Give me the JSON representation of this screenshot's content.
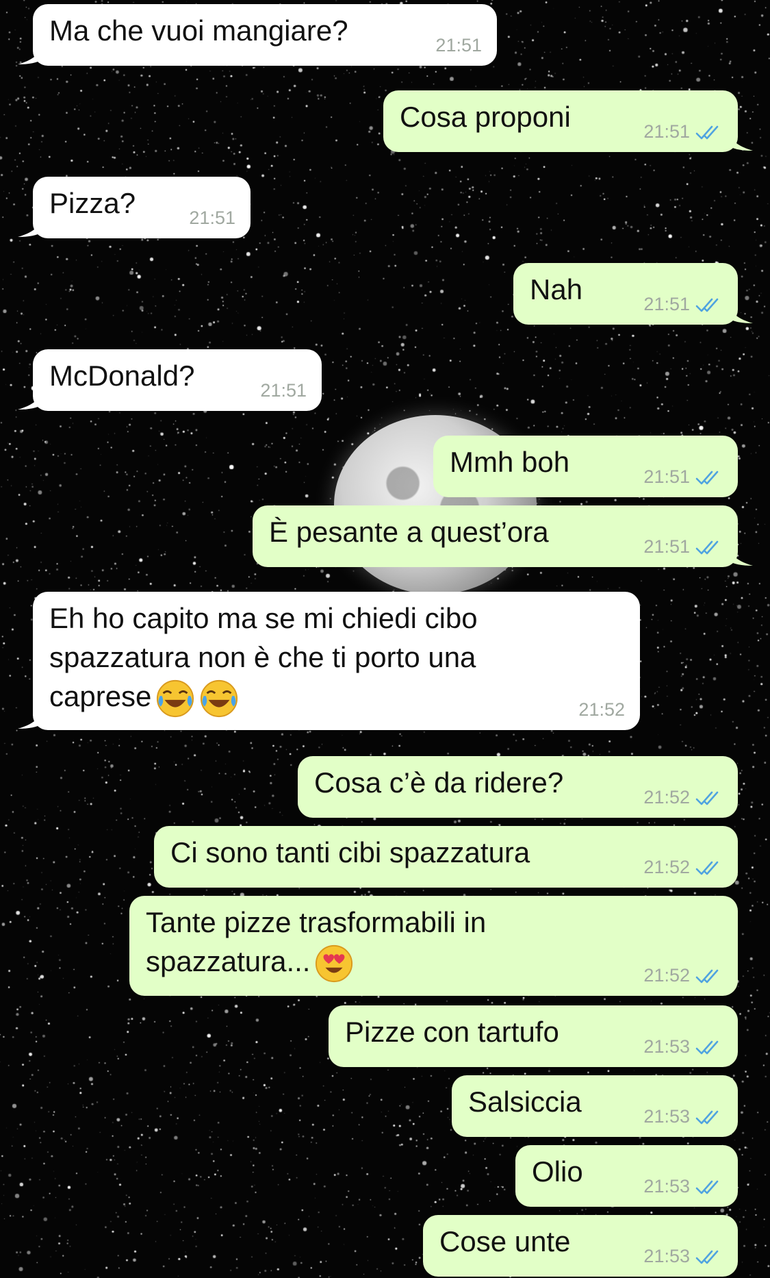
{
  "messages": [
    {
      "dir": "in",
      "text": "Ma che vuoi mangiare?",
      "time": "21:51"
    },
    {
      "dir": "out",
      "text": "Cosa proponi",
      "time": "21:51"
    },
    {
      "dir": "in",
      "text": "Pizza?",
      "time": "21:51"
    },
    {
      "dir": "out",
      "text": "Nah",
      "time": "21:51"
    },
    {
      "dir": "in",
      "text": "McDonald?",
      "time": "21:51"
    },
    {
      "dir": "out",
      "text": "Mmh boh",
      "time": "21:51"
    },
    {
      "dir": "out",
      "text": "È pesante a quest’ora",
      "time": "21:51"
    },
    {
      "dir": "in",
      "text": "Eh ho capito ma se mi chiedi cibo\nspazzatura non è che ti porto una\ncaprese",
      "emoji": [
        "face-with-tears-of-joy-icon",
        "face-with-tears-of-joy-icon"
      ],
      "time": "21:52"
    },
    {
      "dir": "out",
      "text": "Cosa c’è da ridere?",
      "time": "21:52"
    },
    {
      "dir": "out",
      "text": "Ci sono tanti cibi spazzatura",
      "time": "21:52"
    },
    {
      "dir": "out",
      "text": "Tante pizze trasformabili in\nspazzatura...",
      "emoji": [
        "heart-eyes-face-icon"
      ],
      "time": "21:52"
    },
    {
      "dir": "out",
      "text": "Pizze con tartufo",
      "time": "21:53"
    },
    {
      "dir": "out",
      "text": "Salsiccia",
      "time": "21:53"
    },
    {
      "dir": "out",
      "text": "Olio",
      "time": "21:53"
    },
    {
      "dir": "out",
      "text": "Cose unte",
      "time": "21:53"
    }
  ],
  "colors": {
    "incoming": "#ffffff",
    "outgoing": "#e2ffc7",
    "read_check": "#4fa3e0",
    "time": "#a0a8a0"
  },
  "icons": {
    "read_receipt": "double-check-icon"
  }
}
